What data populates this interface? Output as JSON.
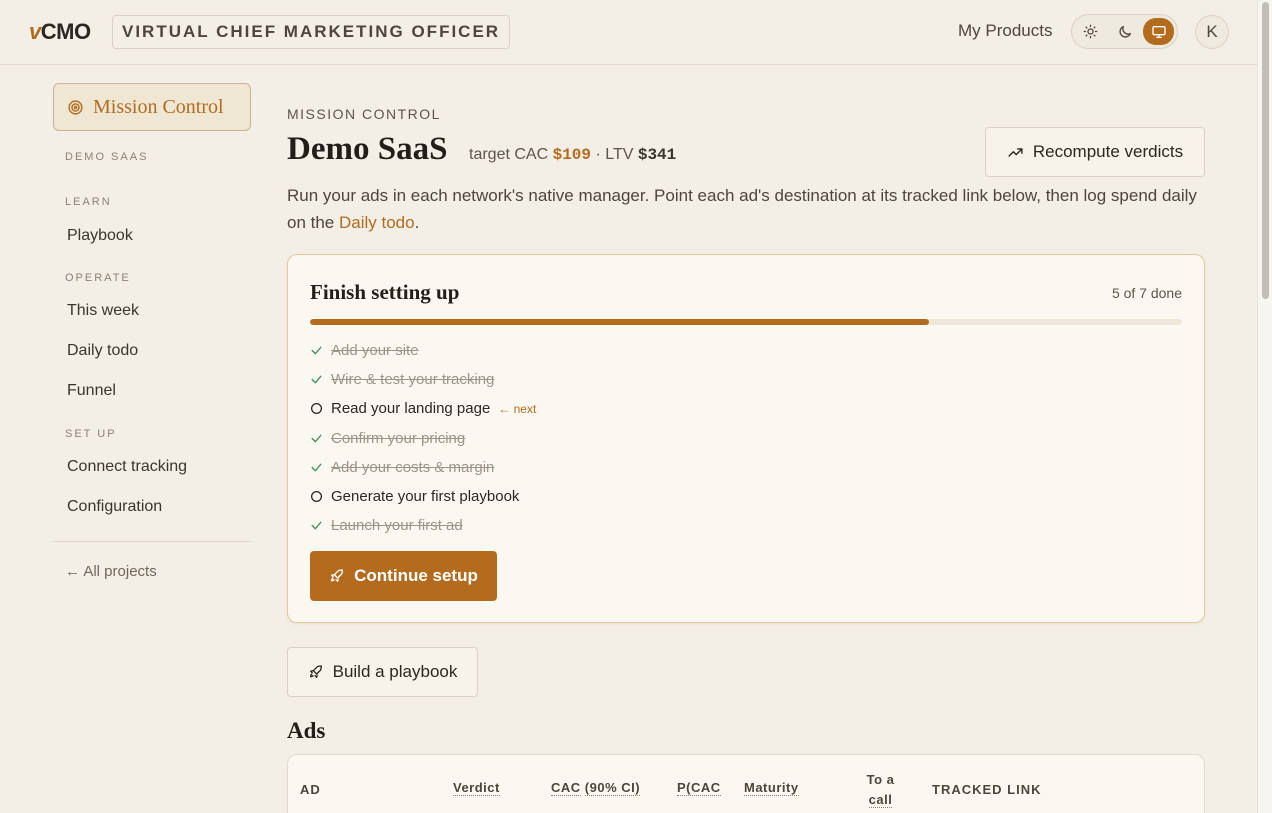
{
  "header": {
    "logo_v": "v",
    "logo_rest": "CMO",
    "tagline": "VIRTUAL CHIEF MARKETING OFFICER",
    "my_products": "My Products",
    "theme_active": "system",
    "avatar_initial": "K"
  },
  "sidebar": {
    "mission_control": "Mission Control",
    "project_label": "DEMO SAAS",
    "sections": [
      {
        "title": "LEARN",
        "items": [
          "Playbook"
        ]
      },
      {
        "title": "OPERATE",
        "items": [
          "This week",
          "Daily todo",
          "Funnel"
        ]
      },
      {
        "title": "SET UP",
        "items": [
          "Connect tracking",
          "Configuration"
        ]
      }
    ],
    "all_projects": "← All projects"
  },
  "main": {
    "kicker": "MISSION CONTROL",
    "title": "Demo SaaS",
    "target_cac_label": "target CAC",
    "target_cac_value": "$109",
    "separator": "·",
    "ltv_label": "LTV",
    "ltv_value": "$341",
    "recompute_label": "Recompute verdicts",
    "intro_text": "Run your ads in each network's native manager. Point each ad's destination at its tracked link below, then log spend daily on the",
    "intro_link": "Daily todo",
    "intro_end": "."
  },
  "setup": {
    "title": "Finish setting up",
    "count_text": "5 of 7 done",
    "progress_fraction": 0.71,
    "steps": [
      {
        "label": "Add your site",
        "done": true
      },
      {
        "label": "Wire & test your tracking",
        "done": true
      },
      {
        "label": "Read your landing page",
        "done": false,
        "badge": "← next"
      },
      {
        "label": "Confirm your pricing",
        "done": true
      },
      {
        "label": "Add your costs & margin",
        "done": true
      },
      {
        "label": "Generate your first playbook",
        "done": false
      },
      {
        "label": "Launch your first ad",
        "done": true
      }
    ],
    "continue_label": "Continue setup"
  },
  "build_playbook_label": "Build a playbook",
  "ads": {
    "title": "Ads",
    "columns": [
      "AD",
      "Verdict",
      "CAC",
      "(90% CI)",
      "P(CAC",
      "Maturity",
      "To a",
      "call",
      "TRACKED LINK"
    ]
  },
  "colors": {
    "accent": "#b36b1e",
    "background": "#f3efe6",
    "done": "#3f8f5a"
  }
}
